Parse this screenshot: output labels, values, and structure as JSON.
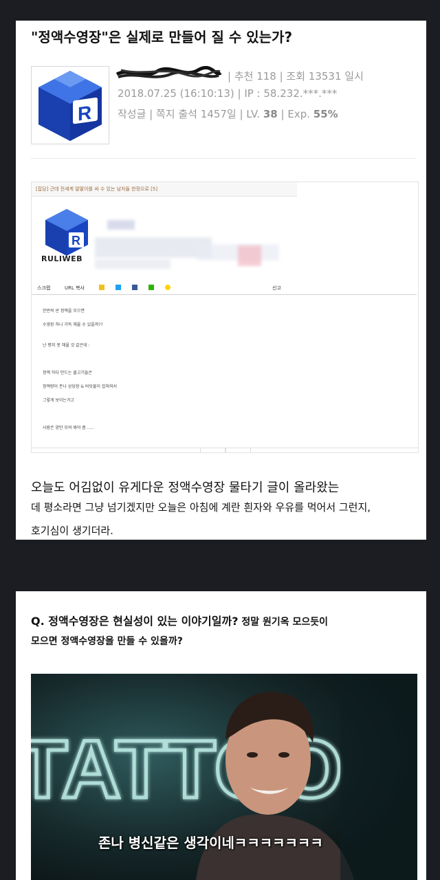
{
  "post": {
    "title": "\"정액수영장\"은 실제로 만들어 질 수 있는가?",
    "meta_line1": "| 추천 118 | 조회 13531 일시",
    "meta_line2": "2018.07.25 (16:10:13) | IP : 58.232.***.***",
    "meta_line3_prefix": "작성글 | 쪽지 출석 1457일 |  LV. ",
    "level": "38",
    "exp_prefix": "  | Exp. ",
    "exp": "55%"
  },
  "embedded_screenshot": {
    "header": "[잡담] 근데 전세계 말딸이를 싸 수 있는 남자들 한정으로 [5]",
    "logo_text": "RULIWEB",
    "toolbar": {
      "scrap": "스크랩",
      "url_copy": "URL 복사",
      "report": "신고"
    },
    "lines": [
      "한번씩 싼 정액을 모으면",
      "수영장 하나 가득 채울 수 있을까??",
      "난 평지 못 채울 것 같은데 :",
      "정액 하다 만드는 물고기들은",
      "정액량이 존나 상당함 & 바닷물이 합쳐져서",
      "그렇게 보이는거고",
      "사람은 양만 모여 봐야 좀 ....."
    ]
  },
  "body": {
    "line1": "오늘도 어김없이 유게다운 정액수영장 물타기 글이 올라왔는",
    "line2": "데 평소라면 그냥 넘기겠지만 오늘은 아침에 계란 흰자와 우유를 먹어서 그런지,",
    "line3": "호기심이 생기더라."
  },
  "question": {
    "line1_main": "Q. 정액수영장은 현실성이 있는 이야기일까?",
    "line1_small": " 정말 원기옥 모으듯이",
    "line2": "모으면 정액수영장을 만들 수 있을까?"
  },
  "meme": {
    "sign_text": "TATTOO",
    "subtitle": "존나 병신같은 생각이네ㅋㅋㅋㅋㅋㅋㅋ"
  },
  "colors": {
    "page_bg": "#1b1d22",
    "card_bg": "#ffffff",
    "logo_blue": "#1f4fc9",
    "meta_gray": "#9a9a9a",
    "exp_gray": "#8a8a8a"
  }
}
